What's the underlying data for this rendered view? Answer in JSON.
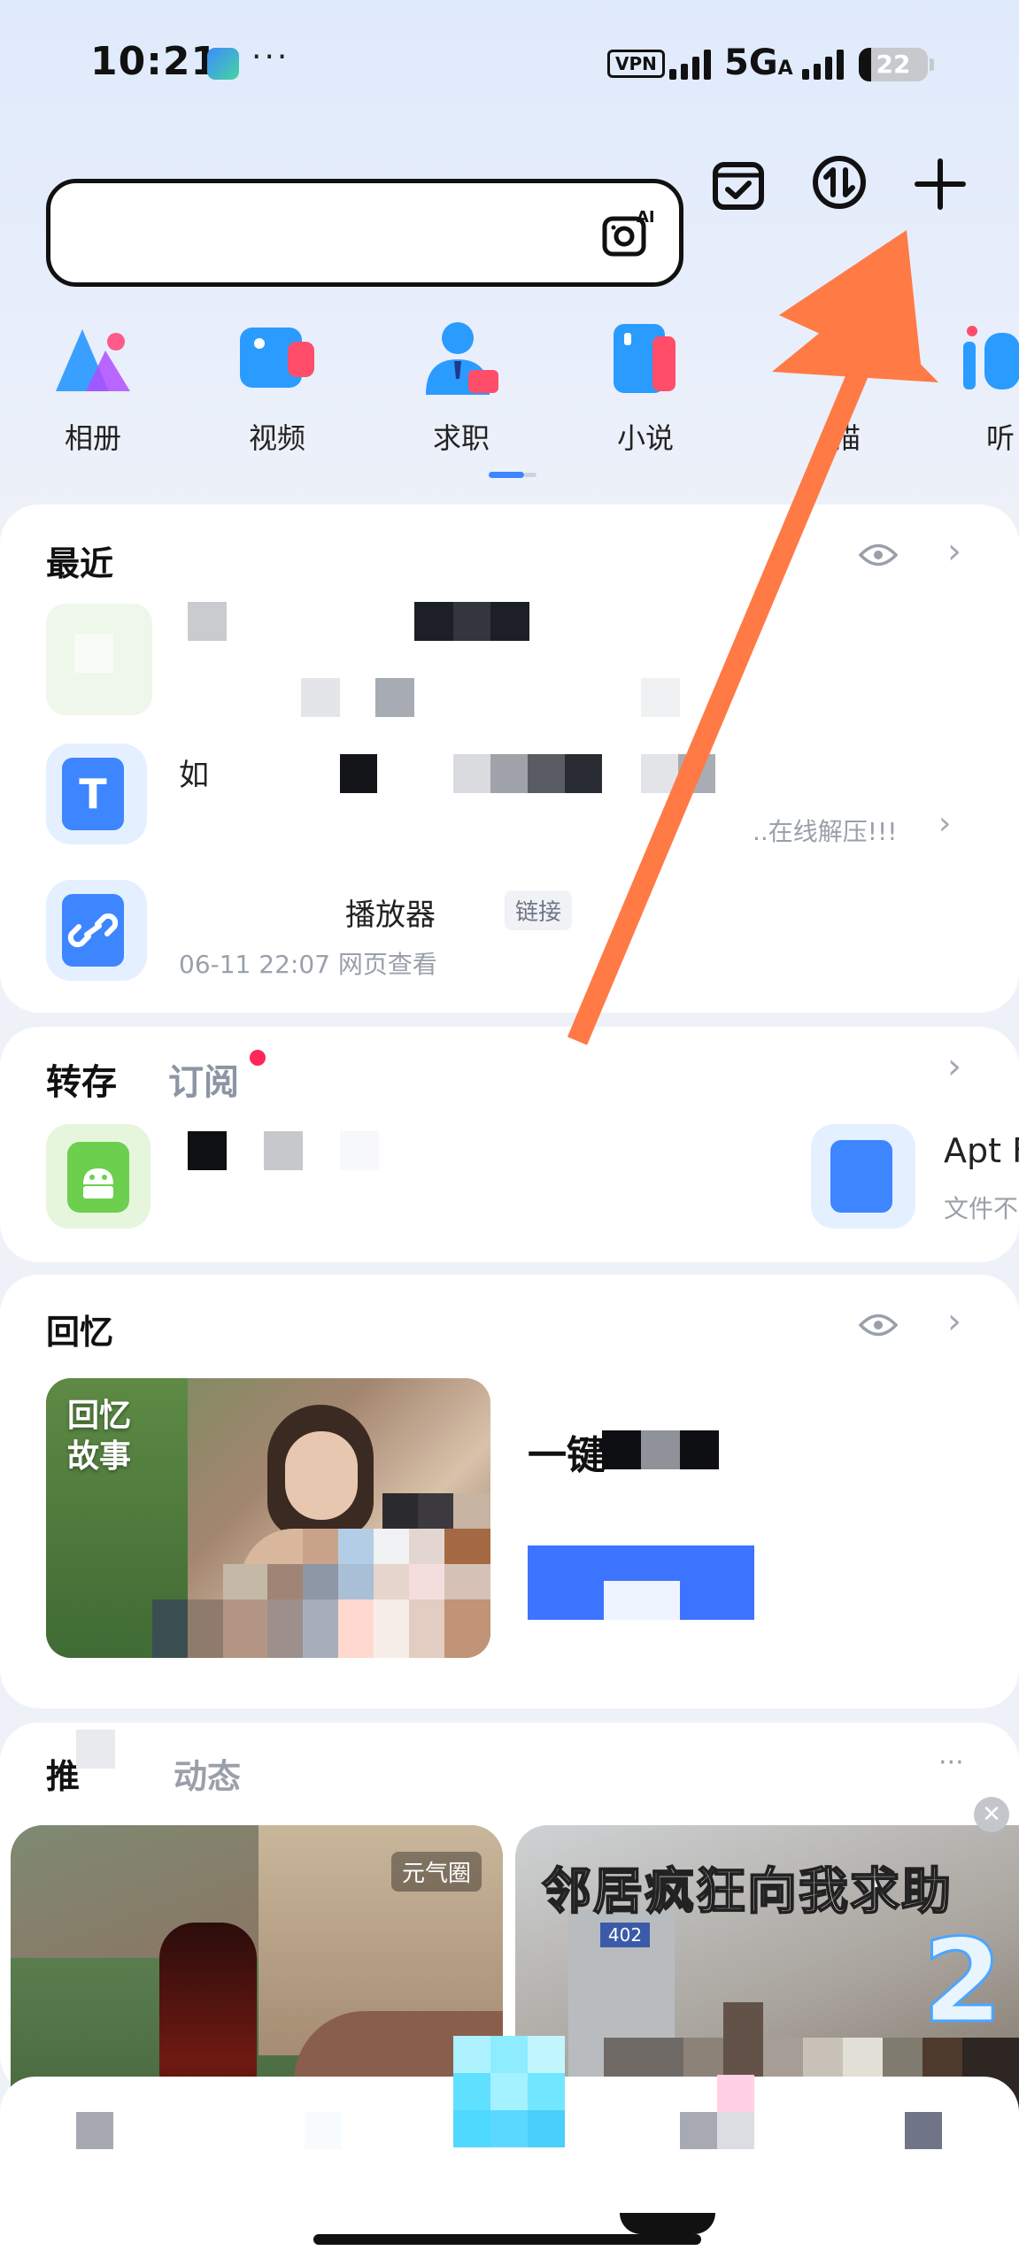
{
  "status_bar": {
    "time": "10:21",
    "dots": "···",
    "vpn": "VPN",
    "network": "5G",
    "network_sub": "A",
    "battery": "22"
  },
  "search": {
    "placeholder": "",
    "camera_ai_icon": "camera-ai-icon"
  },
  "top_icons": [
    "calendar-check-icon",
    "transfer-icon",
    "plus-icon"
  ],
  "categories": [
    {
      "label": "相册",
      "icon": "album-icon"
    },
    {
      "label": "视频",
      "icon": "video-icon"
    },
    {
      "label": "求职",
      "icon": "job-icon"
    },
    {
      "label": "小说",
      "icon": "novel-icon"
    },
    {
      "label": "描",
      "icon": "scan-icon"
    },
    {
      "label": "听",
      "icon": "listen-icon"
    }
  ],
  "recent": {
    "title": "最近",
    "items": [
      {
        "name": "",
        "meta": ""
      },
      {
        "name": "如",
        "meta": "..在线解压!!!"
      },
      {
        "name": "播放器",
        "tag": "链接",
        "meta": "06-11 22:07  网页查看"
      }
    ]
  },
  "saved": {
    "tab_active": "转存",
    "tab_inactive": "订阅",
    "item_right_name": "Apt F",
    "item_right_meta": "文件不"
  },
  "memory": {
    "title": "回忆",
    "badge_line1": "回忆",
    "badge_line2": "故事",
    "side_title": "一键"
  },
  "feed": {
    "section_title": "推",
    "section_title2": "动态",
    "more": "···",
    "left_tag": "元气圈",
    "right_headline": "邻居疯狂向我求助",
    "right_badge": "2",
    "door_number": "402"
  },
  "annotation": {
    "arrow_color": "#ff7a45"
  }
}
